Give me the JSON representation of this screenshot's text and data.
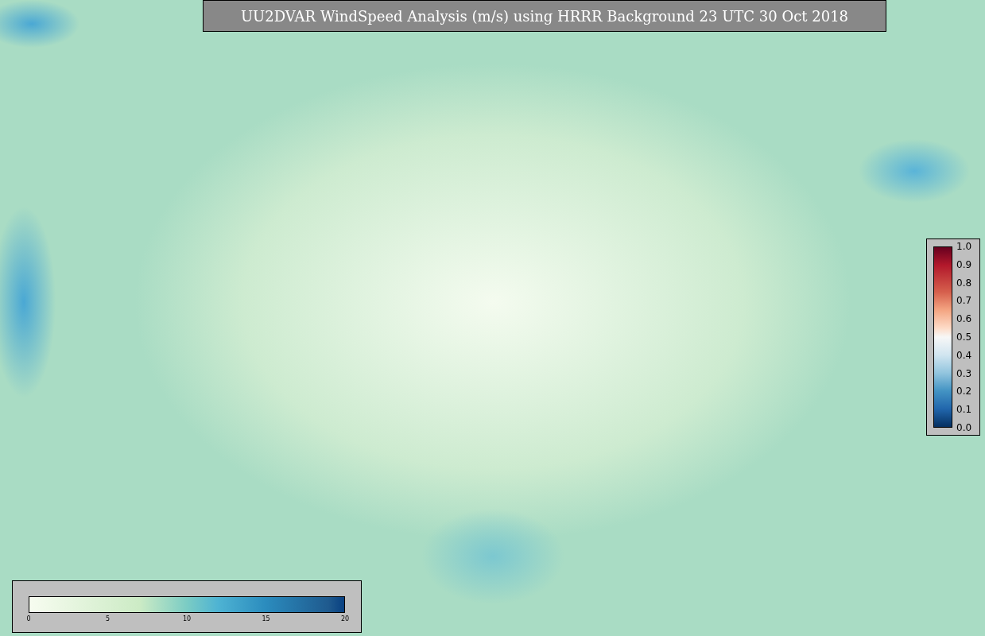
{
  "title": "UU2DVAR WindSpeed Analysis (m/s) using HRRR Background 23 UTC 30 Oct 2018",
  "ratio_colorbar": {
    "ticks": [
      "1.0",
      "0.9",
      "0.8",
      "0.7",
      "0.6",
      "0.5",
      "0.4",
      "0.3",
      "0.2",
      "0.1",
      "0.0"
    ]
  },
  "wind_colorbar": {
    "ticks": [
      "0",
      "5",
      "10",
      "15",
      "20"
    ]
  }
}
